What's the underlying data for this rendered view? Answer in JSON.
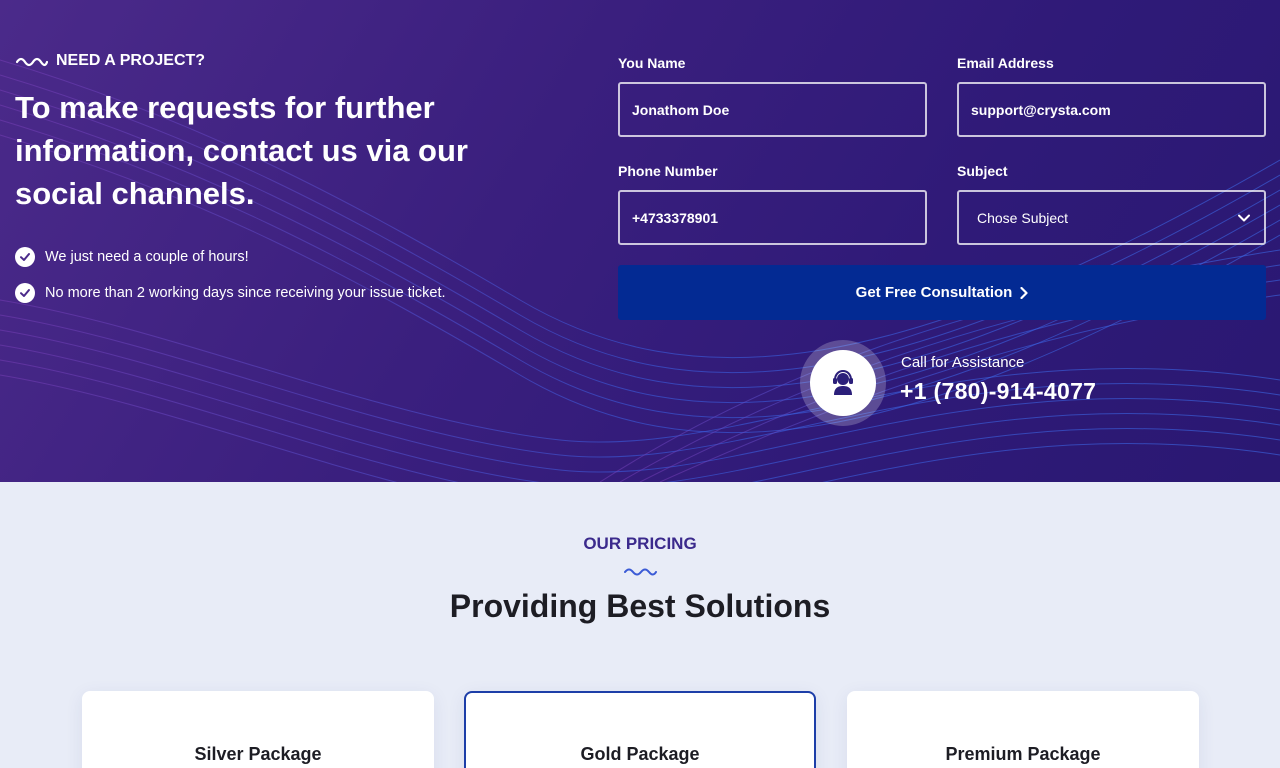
{
  "hero": {
    "eyebrow": "NEED A PROJECT?",
    "headline": "To make requests for further information, contact us via our social channels.",
    "checks": [
      "We just need a couple of hours!",
      "No more than 2 working days since receiving your issue ticket."
    ]
  },
  "form": {
    "name_label": "You Name",
    "name_value": "Jonathom Doe",
    "email_label": "Email Address",
    "email_value": "support@crysta.com",
    "phone_label": "Phone Number",
    "phone_value": "+4733378901",
    "subject_label": "Subject",
    "subject_value": "Chose Subject",
    "submit_label": "Get Free Consultation"
  },
  "assistance": {
    "label": "Call for Assistance",
    "phone": "+1 (780)-914-4077",
    "icon": "headset-user-icon"
  },
  "pricing": {
    "eyebrow": "OUR PRICING",
    "title": "Providing Best Solutions",
    "cards": [
      {
        "title": "Silver Package"
      },
      {
        "title": "Gold Package"
      },
      {
        "title": "Premium Package"
      }
    ]
  },
  "colors": {
    "hero_bg": "#3a1f7e",
    "cta_bg": "#032a93",
    "accent": "#3b2a8c",
    "page_bg": "#e8ecf7"
  }
}
